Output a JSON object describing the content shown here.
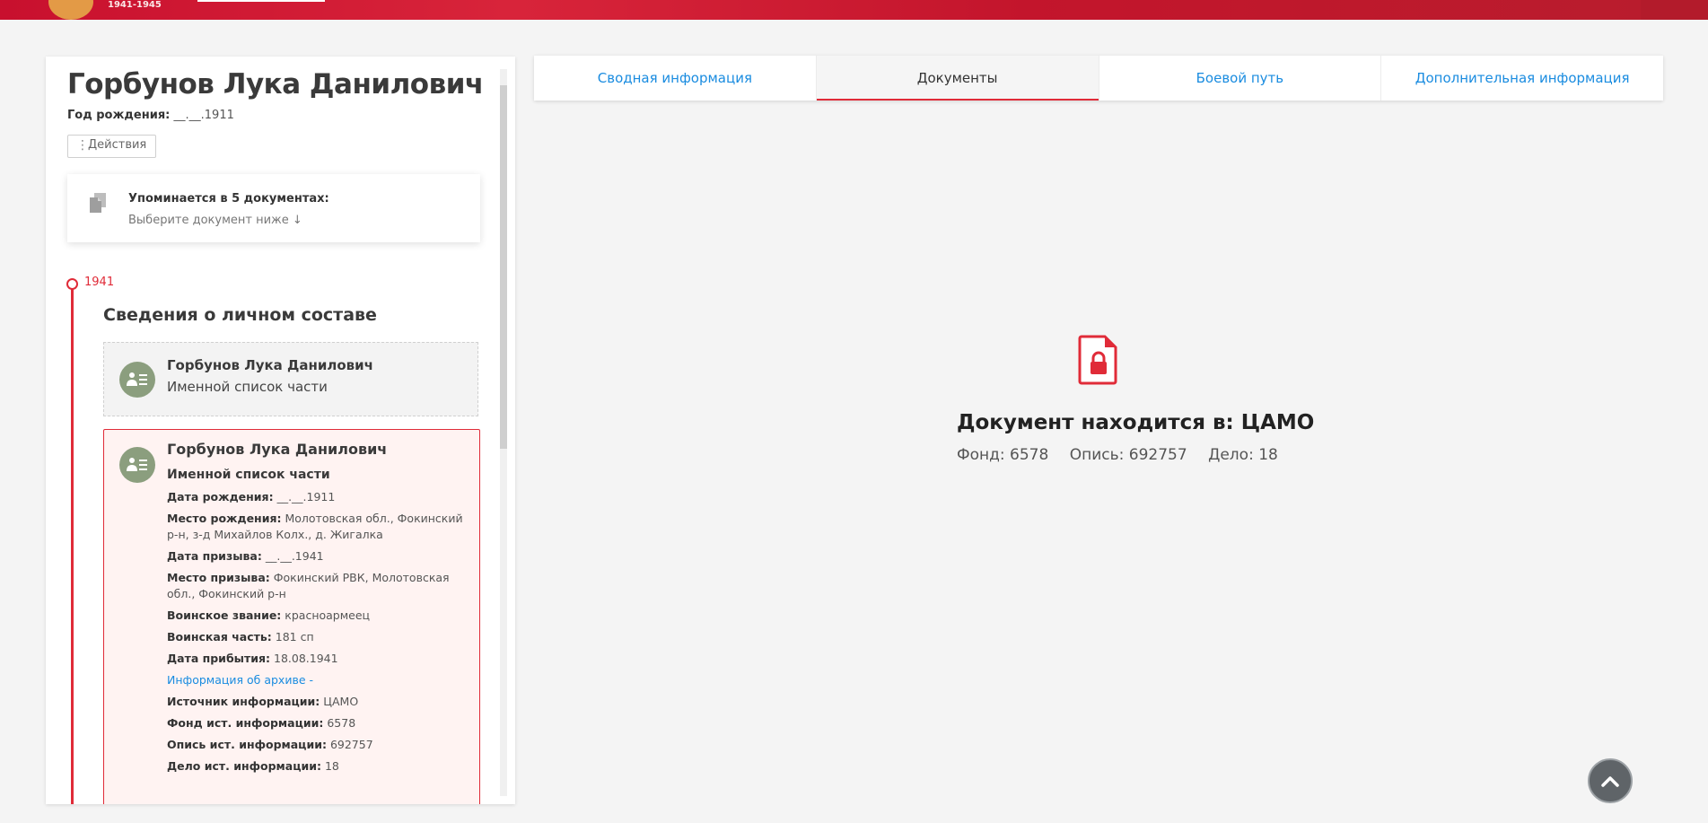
{
  "header": {
    "years": "1941-1945"
  },
  "person": {
    "name": "Горбунов Лука Данилович",
    "birth_label": "Год рождения:",
    "birth_value": "__.__.1911",
    "actions_label": "Действия"
  },
  "mentions": {
    "title": "Упоминается в 5 документах:",
    "subtitle": "Выберите документ ниже ↓"
  },
  "timeline": {
    "year": "1941",
    "section_title": "Сведения о личном составе"
  },
  "doc_cards": [
    {
      "name": "Горбунов Лука Данилович",
      "type": "Именной список части"
    },
    {
      "name": "Горбунов Лука Данилович",
      "type": "Именной список части",
      "fields": [
        {
          "label": "Дата рождения:",
          "value": "__.__.1911"
        },
        {
          "label": "Место рождения:",
          "value": "Молотовская обл., Фокинский р-н, з-д Михайлов Колх., д. Жигалка"
        },
        {
          "label": "Дата призыва:",
          "value": "__.__.1941"
        },
        {
          "label": "Место призыва:",
          "value": "Фокинский РВК, Молотовская обл., Фокинский р-н"
        },
        {
          "label": "Воинское звание:",
          "value": "красноармеец"
        },
        {
          "label": "Воинская часть:",
          "value": "181 сп"
        },
        {
          "label": "Дата прибытия:",
          "value": "18.08.1941"
        }
      ],
      "archive_link": "Информация об архиве -",
      "archive_fields": [
        {
          "label": "Источник информации:",
          "value": "ЦАМО"
        },
        {
          "label": "Фонд ист. информации:",
          "value": "6578"
        },
        {
          "label": "Опись ист. информации:",
          "value": "692757"
        },
        {
          "label": "Дело ист. информации:",
          "value": "18"
        }
      ]
    }
  ],
  "tabs": [
    {
      "label": "Сводная информация",
      "active": false
    },
    {
      "label": "Документы",
      "active": true
    },
    {
      "label": "Боевой путь",
      "active": false
    },
    {
      "label": "Дополнительная информация",
      "active": false
    }
  ],
  "document": {
    "location": "Документ находится в: ЦАМО",
    "fond": "Фонд: 6578",
    "opis": "Опись: 692757",
    "delo": "Дело: 18"
  },
  "icons": {
    "documents": "documents-icon",
    "lock_document": "locked-document-icon",
    "scroll_top": "chevron-up-icon",
    "avatar": "person-list-icon"
  },
  "colors": {
    "accent_red": "#e02b38",
    "link_blue": "#1a8ce0",
    "avatar_green": "#8b9e7e"
  }
}
